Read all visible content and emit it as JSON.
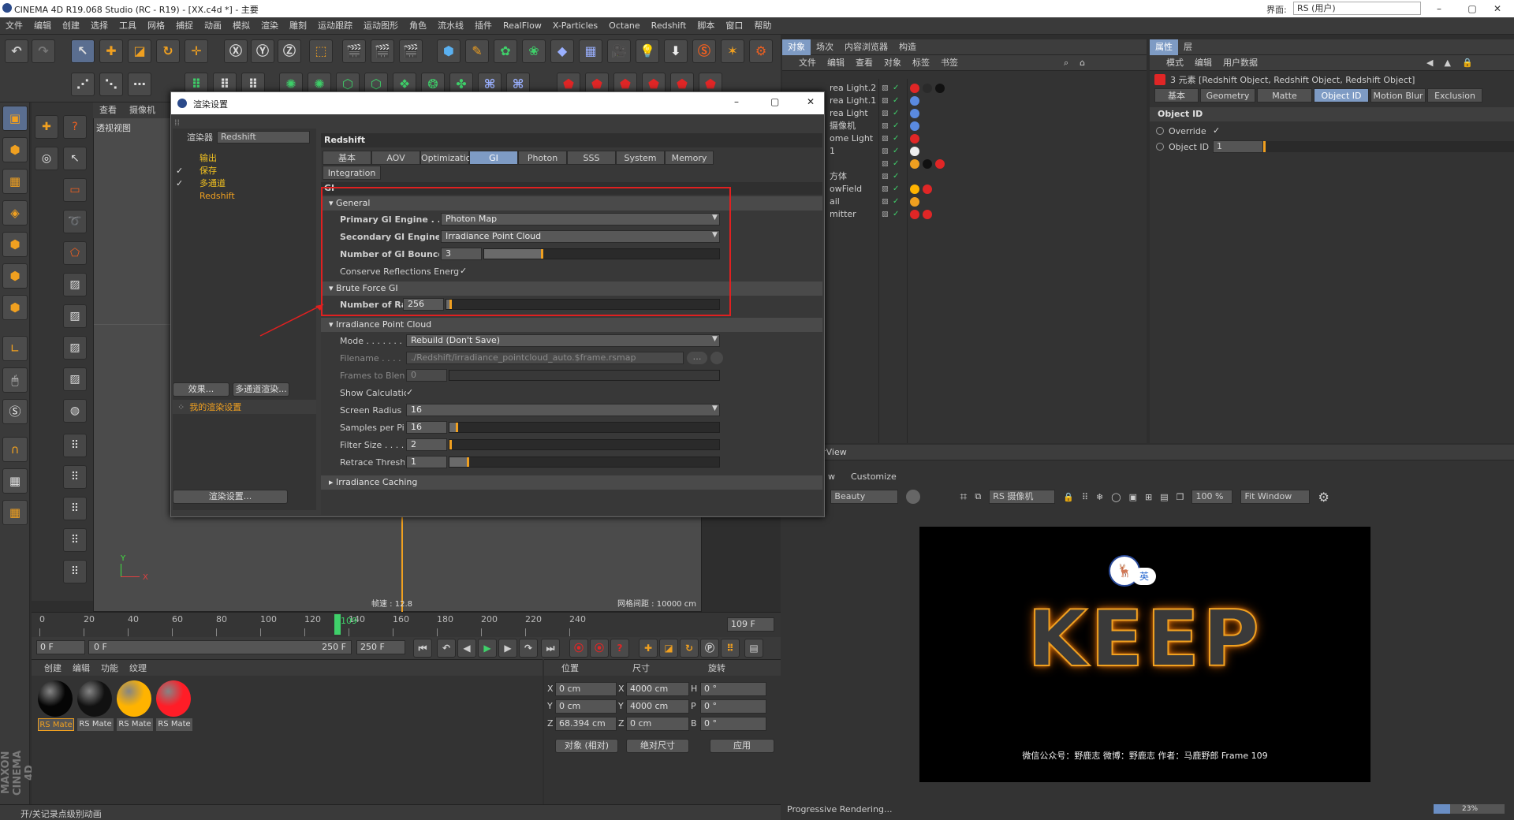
{
  "app": {
    "title": "CINEMA 4D R19.068 Studio (RC - R19) - [XX.c4d *] - 主要",
    "layout_label": "界面:",
    "layout_value": "RS (用户)"
  },
  "menu": [
    "文件",
    "编辑",
    "创建",
    "选择",
    "工具",
    "网格",
    "捕捉",
    "动画",
    "模拟",
    "渲染",
    "雕刻",
    "运动跟踪",
    "运动图形",
    "角色",
    "流水线",
    "插件",
    "RealFlow",
    "X-Particles",
    "Octane",
    "Redshift",
    "脚本",
    "窗口",
    "帮助"
  ],
  "viewport": {
    "tabs": [
      "查看",
      "摄像机"
    ],
    "label": "透视视图",
    "fps": "帧速 : 12.8",
    "grid": "网格间距 : 10000 cm",
    "axis_x": "X",
    "axis_y": "Y"
  },
  "render_settings": {
    "title": "渲染设置",
    "renderer_label": "渲染器",
    "renderer_value": "Redshift",
    "tree": [
      {
        "label": "输出",
        "checked": false
      },
      {
        "label": "保存",
        "checked": true
      },
      {
        "label": "多通道",
        "checked": true
      },
      {
        "label": "Redshift",
        "checked": false
      }
    ],
    "effects_button": "效果...",
    "multipass_button": "多通道渲染...",
    "my_settings": "我的渲染设置",
    "render_settings_button": "渲染设置...",
    "header": "Redshift",
    "tabs": [
      "基本",
      "AOV",
      "Optimization",
      "GI",
      "Photon",
      "SSS",
      "System",
      "Memory"
    ],
    "tab_row2": "Integration",
    "active_tab": "GI",
    "group_title": "GI",
    "general": {
      "title": "General",
      "primary_label": "Primary GI Engine . . . . . . . .",
      "primary_value": "Photon Map",
      "secondary_label": "Secondary GI Engine. . . . . .",
      "secondary_value": "Irradiance Point Cloud",
      "bounces_label": "Number of GI Bounces. . . . .",
      "bounces_value": "3",
      "conserve_label": "Conserve Reflections Energy"
    },
    "brute": {
      "title": "Brute Force GI",
      "rays_label": "Number of Rays",
      "rays_value": "256"
    },
    "ipc": {
      "title": "Irradiance Point Cloud",
      "mode_label": "Mode . . . . . . . . . . .",
      "mode_value": "Rebuild (Don't Save)",
      "filename_label": "Filename . . . . . . . .",
      "filename_value": "./Redshift/irradiance_pointcloud_auto.$frame.rsmap",
      "frames_label": "Frames to Blend",
      "frames_value": "0",
      "show_label": "Show Calculation",
      "radius_label": "Screen Radius . . . .",
      "radius_value": "16",
      "samples_label": "Samples per Pixel",
      "samples_value": "16",
      "filter_label": "Filter Size . . . . . .",
      "filter_value": "2",
      "retrace_label": "Retrace Threshold",
      "retrace_value": "1"
    },
    "caching": "Irradiance Caching"
  },
  "object_manager": {
    "tabs": [
      "对象",
      "场次",
      "内容浏览器",
      "构造"
    ],
    "menu": [
      "文件",
      "编辑",
      "查看",
      "对象",
      "标签",
      "书签"
    ],
    "objects": [
      "rea Light.2",
      "rea Light.1",
      "rea Light",
      "摄像机",
      "ome Light",
      "1",
      "",
      "方体",
      "owField",
      "ail",
      "mitter"
    ]
  },
  "attributes": {
    "tabs": [
      "属性",
      "层"
    ],
    "menu": [
      "模式",
      "编辑",
      "用户数据"
    ],
    "summary": "3 元素 [Redshift Object, Redshift Object, Redshift Object]",
    "subtabs": [
      "基本",
      "Geometry",
      "Matte",
      "Object ID",
      "Motion Blur",
      "Exclusion"
    ],
    "active_subtab": "Object ID",
    "section": "Object ID",
    "override_label": "Override",
    "objid_label": "Object ID",
    "objid_value": "1"
  },
  "renderview": {
    "title": "ft RenderView",
    "menu": [
      "w",
      "Customize"
    ],
    "aov": "Beauty",
    "camera": "RS 摄像机",
    "zoom": "100 %",
    "fit": "Fit Window",
    "keep": "KEEP",
    "badge": "英",
    "caption": "微信公众号：野鹿志   微博：野鹿志   作者：马鹿野郎  Frame  109",
    "status": "Progressive Rendering...",
    "progress_pct": 23,
    "progress_text": "23%"
  },
  "timeline": {
    "ticks": [
      "0",
      "20",
      "40",
      "60",
      "80",
      "100",
      "120",
      "140",
      "160",
      "180",
      "200",
      "220",
      "240"
    ],
    "current": "109",
    "current_field": "109 F",
    "start": "0 F",
    "range_start": "0 F",
    "range_end": "250 F",
    "end": "250 F"
  },
  "materials": {
    "menu": [
      "创建",
      "编辑",
      "功能",
      "纹理"
    ],
    "items": [
      {
        "label": "RS Mate",
        "color": "#050505"
      },
      {
        "label": "RS Mate",
        "color": "#111111"
      },
      {
        "label": "RS Mate",
        "color": "#ffb300"
      },
      {
        "label": "RS Mate",
        "color": "#ff1d27"
      }
    ]
  },
  "coords": {
    "headers": [
      "位置",
      "尺寸",
      "旋转"
    ],
    "x_pos": "0 cm",
    "y_pos": "0 cm",
    "z_pos": "68.394 cm",
    "x_size": "4000 cm",
    "y_size": "4000 cm",
    "z_size": "0 cm",
    "h": "0 °",
    "p": "0 °",
    "b": "0 °",
    "mode": "对象 (相对)",
    "size_mode": "绝对尺寸",
    "apply": "应用",
    "labels": [
      "X",
      "Y",
      "Z",
      "X",
      "Y",
      "Z",
      "H",
      "P",
      "B"
    ]
  },
  "status": "开/关记录点级别动画",
  "colors": {
    "accent": "#f0a020",
    "active_tab": "#7e9bc4",
    "highlight": "#e02020"
  }
}
